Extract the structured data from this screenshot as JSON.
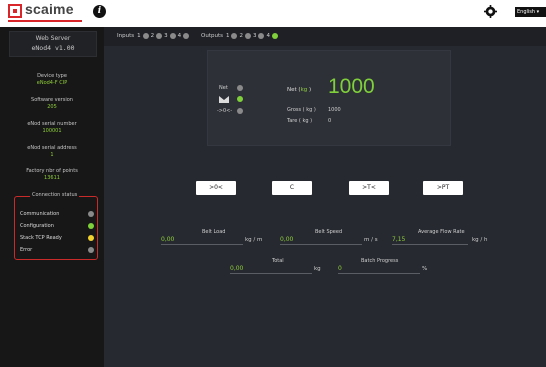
{
  "header": {
    "brand": "scaime",
    "language": "English"
  },
  "sidebar": {
    "title": "Web Server",
    "subtitle": "eNod4 v1.00",
    "fields": [
      {
        "label": "Device type",
        "value": "eNod4-F CIP"
      },
      {
        "label": "Software version",
        "value": "205"
      },
      {
        "label": "eNod serial number",
        "value": "100001"
      },
      {
        "label": "eNod serial address",
        "value": "1"
      },
      {
        "label": "Factory nbr of points",
        "value": "13611"
      }
    ],
    "connection": {
      "title": "Connection status",
      "items": [
        {
          "label": "Communication",
          "color": "#8a8a8a"
        },
        {
          "label": "Configuration",
          "color": "#7fd03a"
        },
        {
          "label": "Stack TCP Ready",
          "color": "#f2d22e"
        },
        {
          "label": "Error",
          "color": "#8a8a8a"
        }
      ]
    }
  },
  "io": {
    "inputs_label": "Inputs",
    "inputs": [
      {
        "num": "1",
        "color": "#8a8a8a"
      },
      {
        "num": "2",
        "color": "#8a8a8a"
      },
      {
        "num": "3",
        "color": "#8a8a8a"
      },
      {
        "num": "4",
        "color": "#8a8a8a"
      }
    ],
    "outputs_label": "Outputs",
    "outputs": [
      {
        "num": "1",
        "color": "#8a8a8a"
      },
      {
        "num": "2",
        "color": "#8a8a8a"
      },
      {
        "num": "3",
        "color": "#8a8a8a"
      },
      {
        "num": "4",
        "color": "#7fd03a"
      }
    ]
  },
  "weight": {
    "indicators": [
      {
        "label": "Net",
        "color": "#8a8a8a"
      },
      {
        "label": "stable-icon",
        "color": "#7fd03a"
      },
      {
        "label": "->0<-",
        "color": "#8a8a8a"
      }
    ],
    "net_label": "Net (",
    "net_unit": "kg",
    "net_close": " )",
    "net_value": "1000",
    "gross_label": "Gross ( kg )",
    "gross_value": "1000",
    "tare_label": "Tare ( kg )",
    "tare_value": "0"
  },
  "buttons": [
    {
      "label": ">0<"
    },
    {
      "label": "C"
    },
    {
      "label": ">T<"
    },
    {
      "label": ">PT"
    }
  ],
  "metrics": {
    "belt_load": {
      "label": "Belt Load",
      "value": "0,00",
      "unit": "kg / m"
    },
    "belt_speed": {
      "label": "Belt Speed",
      "value": "0,00",
      "unit": "m / s"
    },
    "flow_rate": {
      "label": "Average Flow Rate",
      "value": "7,15",
      "unit": "kg / h"
    },
    "total": {
      "label": "Total",
      "value": "0,00",
      "unit": "kg"
    },
    "batch": {
      "label": "Batch Progress",
      "value": "0",
      "unit": "%"
    }
  }
}
